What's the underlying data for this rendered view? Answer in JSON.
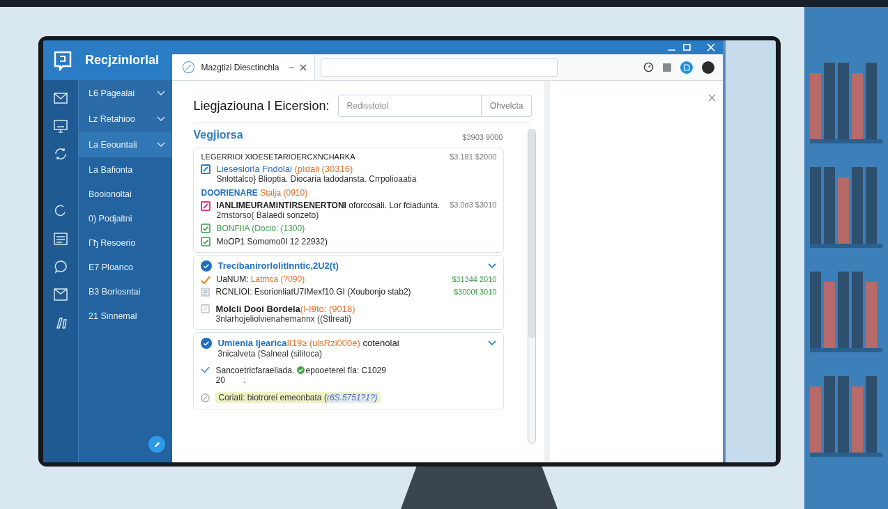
{
  "app": {
    "title": "Recjzinlorlal"
  },
  "nav": [
    {
      "label": "L6 Pagealai",
      "expandable": true,
      "selected": false
    },
    {
      "label": "Lz Retahioo",
      "expandable": true,
      "selected": false
    },
    {
      "label": "La Eeountali",
      "expandable": true,
      "selected": true
    },
    {
      "label": "La Bafionta",
      "expandable": false,
      "selected": false
    },
    {
      "label": "Booionoltai",
      "expandable": false,
      "selected": false
    },
    {
      "label": "0) Podjaltni",
      "expandable": false,
      "selected": false
    },
    {
      "label": "Γђ Resoerio",
      "expandable": false,
      "selected": false
    },
    {
      "label": "E7 Ploanco",
      "expandable": false,
      "selected": false
    },
    {
      "label": "B3 Borlosntai",
      "expandable": false,
      "selected": false
    },
    {
      "label": "21 Sinnemal",
      "expandable": false,
      "selected": false
    }
  ],
  "tab": {
    "title": "Mazgtizi Diesctinchla",
    "minimize": "–"
  },
  "header": {
    "title": "Liegjaziouna I Eicersion:",
    "search_placeholder": "Redisstotol",
    "button": "Ohvelcta"
  },
  "section": {
    "title": "Vegjiorsa",
    "amount": "$3903 9000"
  },
  "cards": [
    {
      "kind": "plain",
      "heading": "LEGERRIOI XIOESETARIOERCXNCHARKA",
      "amount": "$3.181 $2000",
      "rows": [
        {
          "kind": "entry",
          "color": "#2a7bc4",
          "title": "Liesesiorla Fndolai",
          "note": "(pIdali (30316)",
          "subtitle": "Snlottalco} Blioptia. Diocaria ladodansta. Crrpolioaatia"
        },
        {
          "kind": "group",
          "title": "DOORIENARE",
          "note": "Stalja (0910)"
        },
        {
          "kind": "entry",
          "color": "#e0358f",
          "title": "IANLIMEURAMINTIRSENERTONI",
          "rest": " oforcosali. Lor fciadunta.",
          "subtitle": "2rnstorso( Balaedi sonzeto)",
          "amount": "$3.0d3 $3010"
        },
        {
          "kind": "check",
          "checked": true,
          "color": "#3a9a48",
          "title": "BONFIIA (Docio: (1300)"
        },
        {
          "kind": "check",
          "checked": true,
          "color": "#222222",
          "title": "MoOP1 Somomo0I 12 22932)"
        }
      ]
    },
    {
      "kind": "collapsible",
      "checked": true,
      "heading": "Trecibanirorlolitlnntic,2U2(t)",
      "rows": [
        {
          "kind": "tick",
          "title": "UaNUM:",
          "note": "Latmca (?090)",
          "amount": "$31344 2010"
        },
        {
          "kind": "doc",
          "title": "RCNLIOI: EsorionliatU7IMexf10.GI (Xoubonjo stab2)",
          "amount": "$3000ɬ 3010"
        },
        {
          "kind": "bold",
          "title": "Molcli Dooi Bordela",
          "note": "(I-I9to: (9018)",
          "subtitle": "3nlarhojeliolvienahemannx ((Stlreati)"
        }
      ]
    },
    {
      "kind": "collapsible",
      "checked": true,
      "heading": "Umienia Ijearica",
      "note": "II19≥ (ulsRzi000e)",
      "rest": " cotenolai",
      "subheading": "3nicalveta (Salneal (silitoca)",
      "rows": [
        {
          "kind": "confirm",
          "title": "Sancoetricfaraeliada.",
          "rest": "epooeterel fía: C1029",
          "line2": "20        ."
        },
        {
          "kind": "tag",
          "title": "Coriati: biotrorei emeonbata (",
          "note": "r6S.5751?1?)"
        }
      ]
    }
  ]
}
